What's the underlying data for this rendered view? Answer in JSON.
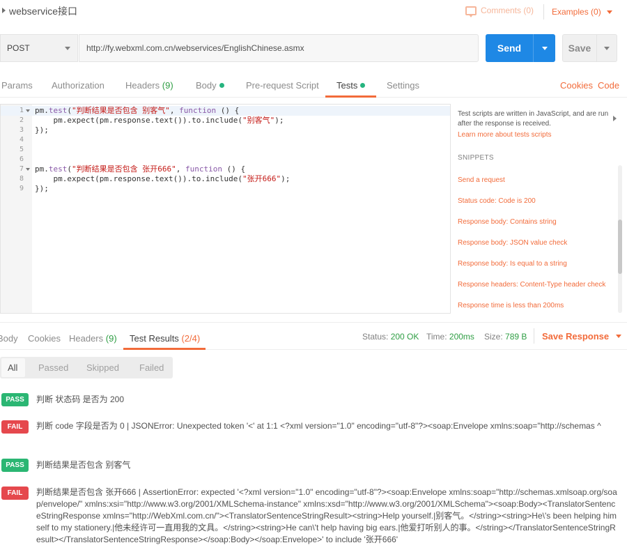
{
  "titlebar": {
    "title": "webservice接口",
    "comments": "Comments (0)",
    "examples": "Examples (0)"
  },
  "request": {
    "method": "POST",
    "url": "http://fy.webxml.com.cn/webservices/EnglishChinese.asmx",
    "send_label": "Send",
    "save_label": "Save"
  },
  "tabs": {
    "params": "Params",
    "authorization": "Authorization",
    "headers": "Headers",
    "headers_count": "(9)",
    "body": "Body",
    "prerequest": "Pre-request Script",
    "tests": "Tests",
    "settings": "Settings",
    "cookies": "Cookies",
    "code": "Code"
  },
  "editor": {
    "line_numbers": [
      "1",
      "2",
      "3",
      "4",
      "5",
      "6",
      "7",
      "8",
      "9"
    ],
    "l1_a": "pm.",
    "l1_fn": "test",
    "l1_b": "(",
    "l1_str": "\"判断结果是否包含 别客气\"",
    "l1_c": ", ",
    "l1_kw": "function",
    "l1_d": " () {",
    "l2_a": "    pm.expect(pm.response.text()).to.include(",
    "l2_str": "\"别客气\"",
    "l2_b": ");",
    "l3": "});",
    "l7_a": "pm.",
    "l7_fn": "test",
    "l7_b": "(",
    "l7_str": "\"判断结果是否包含 张开666\"",
    "l7_c": ", ",
    "l7_kw": "function",
    "l7_d": " () {",
    "l8_a": "    pm.expect(pm.response.text()).to.include(",
    "l8_str": "\"张开666\"",
    "l8_b": ");",
    "l9": "});"
  },
  "helper": {
    "intro": "Test scripts are written in JavaScript, and are run after the response is received.",
    "learn": "Learn more about tests scripts",
    "snippets_heading": "SNIPPETS",
    "snippets": [
      "Send a request",
      "Status code: Code is 200",
      "Response body: Contains string",
      "Response body: JSON value check",
      "Response body: Is equal to a string",
      "Response headers: Content-Type header check",
      "Response time is less than 200ms"
    ]
  },
  "response": {
    "body": "Body",
    "cookies": "Cookies",
    "headers": "Headers",
    "headers_count": "(9)",
    "test_results": "Test Results",
    "test_results_count": "(2/4)",
    "status_label": "Status:",
    "status_value": "200 OK",
    "time_label": "Time:",
    "time_value": "200ms",
    "size_label": "Size:",
    "size_value": "789 B",
    "save_response": "Save Response"
  },
  "filters": {
    "all": "All",
    "passed": "Passed",
    "skipped": "Skipped",
    "failed": "Failed"
  },
  "results": [
    {
      "status": "PASS",
      "text": "判断 状态码 是否为 200"
    },
    {
      "status": "FAIL",
      "text": "判断 code 字段是否为 0 | JSONError: Unexpected token '<' at 1:1 <?xml version=\"1.0\" encoding=\"utf-8\"?><soap:Envelope xmlns:soap=\"http://schemas ^"
    },
    {
      "status": "PASS",
      "text": "判断结果是否包含 别客气"
    },
    {
      "status": "FAIL",
      "text": "判断结果是否包含 张开666 | AssertionError: expected '<?xml version=\"1.0\" encoding=\"utf-8\"?><soap:Envelope xmlns:soap=\"http://schemas.xmlsoap.org/soap/envelope/\" xmlns:xsi=\"http://www.w3.org/2001/XMLSchema-instance\" xmlns:xsd=\"http://www.w3.org/2001/XMLSchema\"><soap:Body><TranslatorSentenceStringResponse xmlns=\"http://WebXml.com.cn/\"><TranslatorSentenceStringResult><string>Help yourself.|别客气。</string><string>He\\'s been helping himself to my stationery.|他未经许可一直用我的文具。</string><string>He can\\'t help having big ears.|他爱打听别人的事。</string></TranslatorSentenceStringResult></TranslatorSentenceStringResponse></soap:Body></soap:Envelope>' to include '张开666'"
    }
  ],
  "colors": {
    "accent": "#f26b3a",
    "send": "#1e88e5",
    "pass": "#2bb673",
    "fail": "#e5484d",
    "count_green": "#2f9e44"
  }
}
